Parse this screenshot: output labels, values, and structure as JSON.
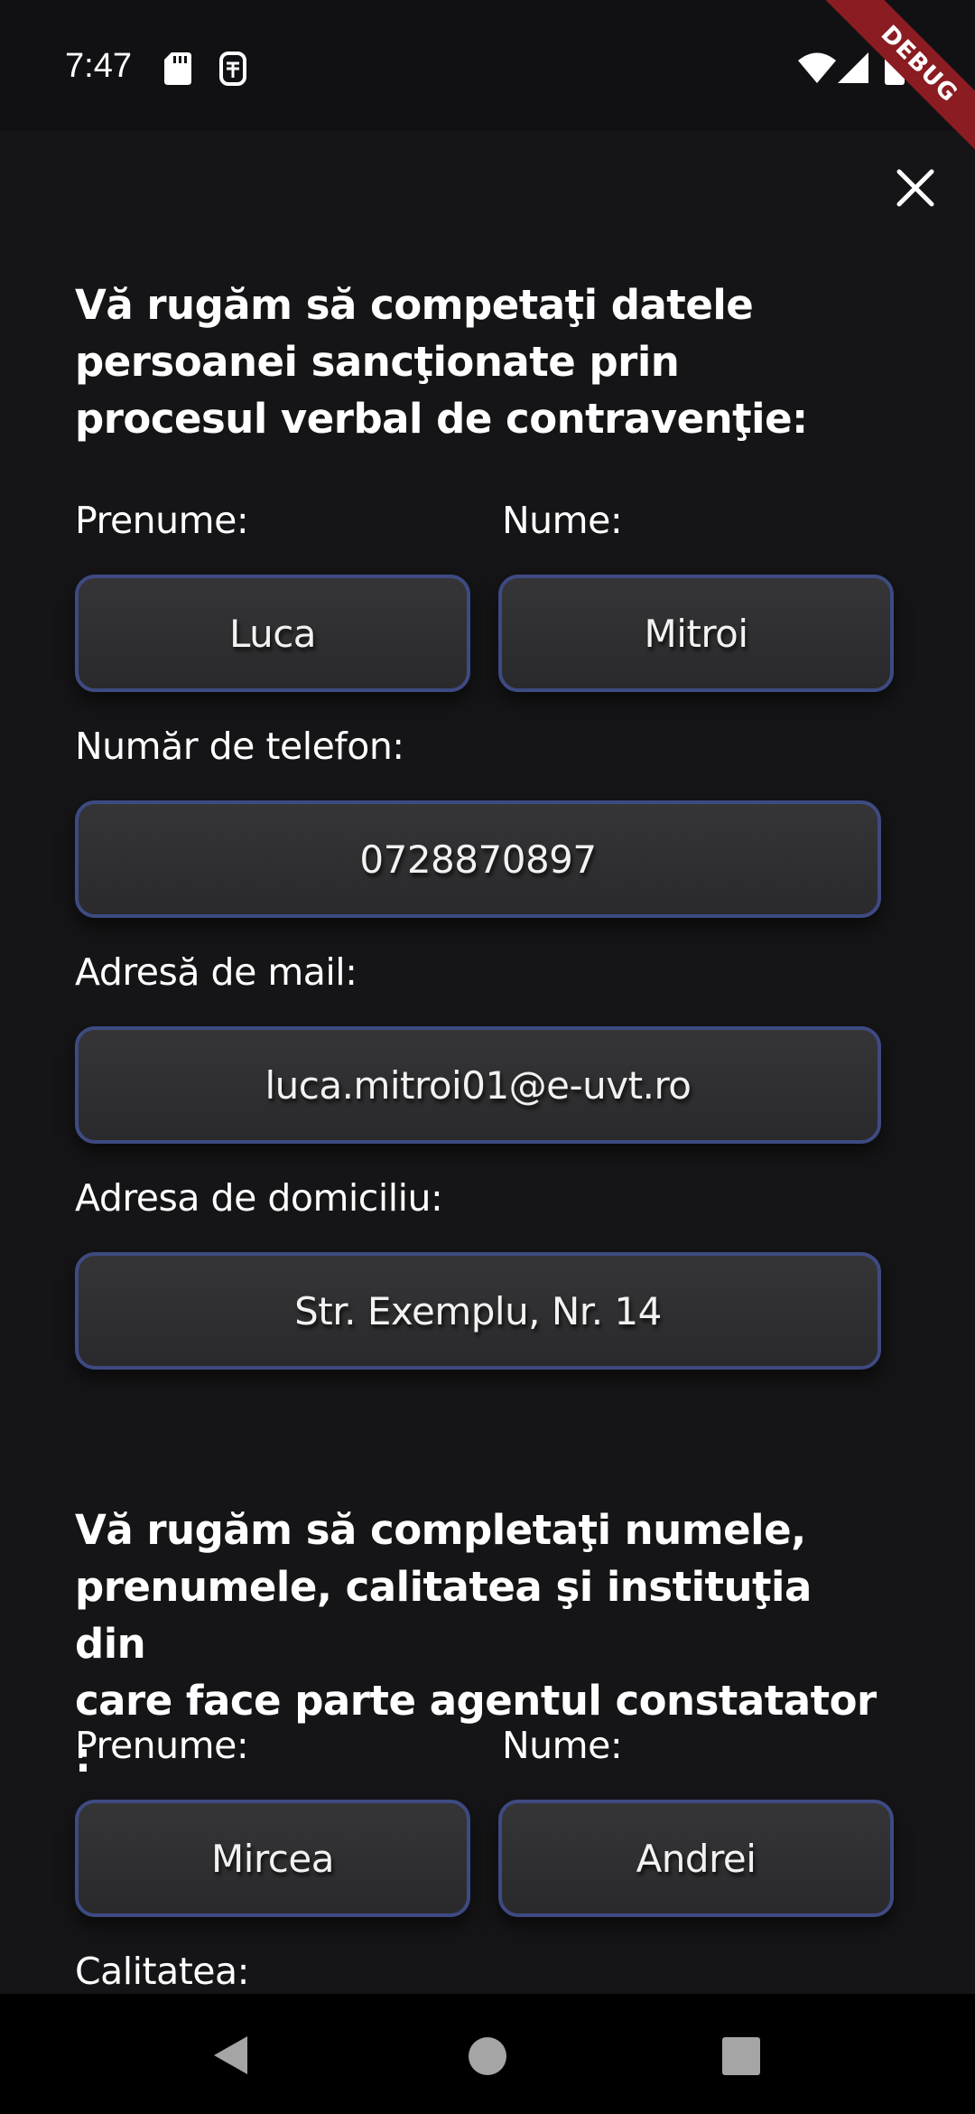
{
  "status_bar": {
    "time": "7:47"
  },
  "debug_banner": "DEBUG",
  "section1": {
    "heading_lines": [
      "Vă rugăm să competaţi datele",
      "persoanei sancţionate prin",
      "procesul verbal de contravenţie:"
    ],
    "prenume_label": "Prenume:",
    "prenume_value": "Luca",
    "nume_label": "Nume:",
    "nume_value": "Mitroi",
    "telefon_label": "Număr de telefon:",
    "telefon_value": "0728870897",
    "mail_label": "Adresă de mail:",
    "mail_value": "luca.mitroi01@e-uvt.ro",
    "domiciliu_label": "Adresa de domiciliu:",
    "domiciliu_value": "Str. Exemplu, Nr. 14"
  },
  "section2": {
    "heading_lines": [
      "Vă rugăm să completaţi numele,",
      "prenumele, calitatea şi instituţia din",
      "care face parte agentul constatator :"
    ],
    "prenume_label": "Prenume:",
    "prenume_value": "Mircea",
    "nume_label": "Nume:",
    "nume_value": "Andrei",
    "calitatea_label": "Calitatea:"
  },
  "colors": {
    "background": "#151517",
    "field_border": "#3e4a82",
    "field_fill": "#2f2f31",
    "debug_ribbon": "#8a1c22"
  }
}
